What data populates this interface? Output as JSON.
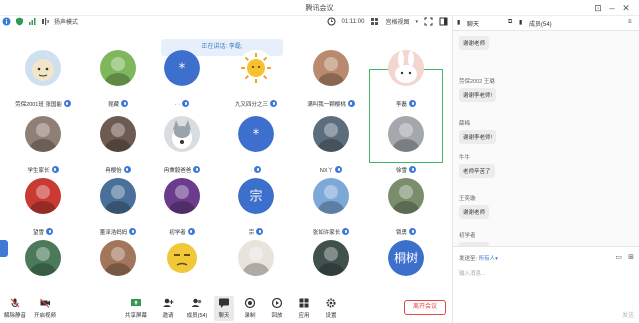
{
  "window": {
    "title": "腾讯会议"
  },
  "toolbar": {
    "mode": "扬声模式",
    "timer": "01:11:00",
    "view": "宫格视图"
  },
  "speaker_banner": "正在讲话: 李磊;",
  "participants": [
    {
      "name": "劳保2001班 张国能",
      "color": "#cfe0f0",
      "kind": "cartoon"
    },
    {
      "name": "昆藏",
      "color": "#7fb85c",
      "kind": "photo"
    },
    {
      "name": "·  ·",
      "color": "#3d6fcc",
      "kind": "text",
      "letter": "*"
    },
    {
      "name": "九又四分之三",
      "color": "#f7c22e",
      "kind": "sun"
    },
    {
      "name": "满叫我一颗樱桃",
      "color": "#b98a6d",
      "kind": "photo"
    },
    {
      "name": "李磊",
      "color": "#f4d5cf",
      "kind": "rabbit"
    },
    {
      "name": "学生家长",
      "color": "#8f7f74",
      "kind": "photo"
    },
    {
      "name": "冉樱怡",
      "color": "#6d5a50",
      "kind": "photo"
    },
    {
      "name": "冉秉毅爸爸",
      "color": "#9aa4ad",
      "kind": "dog"
    },
    {
      "name": "·",
      "color": "#3d6fcc",
      "kind": "text",
      "letter": "*"
    },
    {
      "name": "NX丫",
      "color": "#5c6e7e",
      "kind": "photo"
    },
    {
      "name": "徐雪",
      "color": "#a4a8ad",
      "kind": "photo"
    },
    {
      "name": "望雪",
      "color": "#c83a32",
      "kind": "photo"
    },
    {
      "name": "董泽浩妈妈",
      "color": "#4a6f98",
      "kind": "photo"
    },
    {
      "name": "初学者",
      "color": "#6b3b8d",
      "kind": "photo"
    },
    {
      "name": "宗",
      "color": "#3d6fcc",
      "kind": "text",
      "letter": "宗"
    },
    {
      "name": "张如许家长",
      "color": "#7ea8d8",
      "kind": "photo"
    },
    {
      "name": "锁勇",
      "color": "#7a8e6e",
      "kind": "photo"
    },
    {
      "name": "",
      "color": "#4a7a5a",
      "kind": "photo"
    },
    {
      "name": "",
      "color": "#a2765a",
      "kind": "photo"
    },
    {
      "name": "",
      "color": "#f0c83a",
      "kind": "face"
    },
    {
      "name": "",
      "color": "#e8e4dc",
      "kind": "photo"
    },
    {
      "name": "",
      "color": "#40504c",
      "kind": "photo"
    },
    {
      "name": "",
      "color": "#3d6fcc",
      "kind": "text",
      "letter": "桐树"
    }
  ],
  "bottom": {
    "mute": "解除静音",
    "video": "开启视频",
    "share": "共享屏幕",
    "invite": "邀请",
    "members": "成员(54)",
    "chat": "聊天",
    "record": "录制",
    "replay": "回放",
    "apps": "应用",
    "settings": "设置",
    "leave": "离开会议"
  },
  "panel": {
    "tab_chat": "聊天",
    "tab_members": "成员(54)",
    "messages": [
      {
        "sender": "",
        "text": "谢谢老师"
      },
      {
        "sender": "劳保2002 王璐",
        "text": "谢谢李老师!"
      },
      {
        "sender": "薛梅",
        "text": "谢谢李老师!"
      },
      {
        "sender": "牛牛",
        "text": "老师辛苦了"
      },
      {
        "sender": "王奕璇",
        "text": "谢谢老师"
      },
      {
        "sender": "初学者",
        "text": "谢谢老师"
      }
    ],
    "send_to_label": "发送至:",
    "send_to_value": "所有人▾",
    "input_placeholder": "输入消息...",
    "send": "发送"
  },
  "colors": {
    "accent": "#3d7ad6",
    "leave": "#e54545",
    "selected": "#3cb961"
  }
}
